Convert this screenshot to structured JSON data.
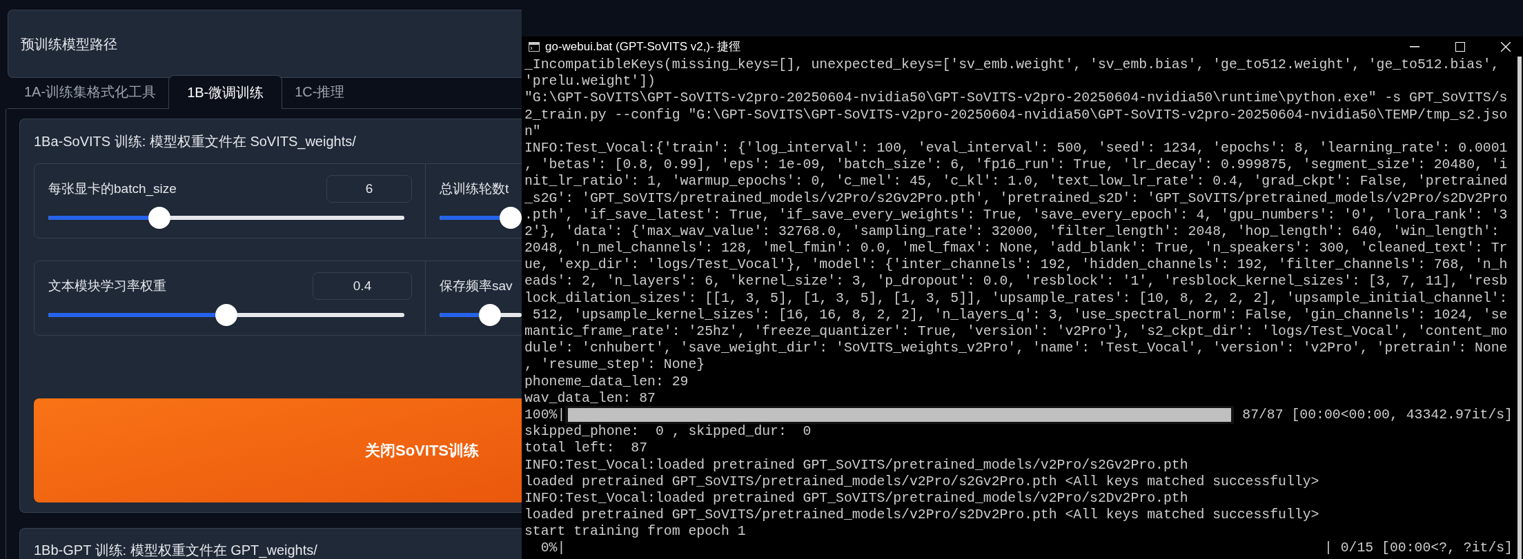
{
  "header": {
    "title": "预训练模型路径"
  },
  "tabs": [
    {
      "label": "1A-训练集格式化工具",
      "selected": false
    },
    {
      "label": "1B-微调训练",
      "selected": true
    },
    {
      "label": "1C-推理",
      "selected": false
    }
  ],
  "sovits_section": {
    "title": "1Ba-SoVITS 训练: 模型权重文件在 SoVITS_weights/",
    "sliders": [
      {
        "label": "每张显卡的batch_size",
        "value": "6",
        "level": 0.3
      },
      {
        "label": "总训练轮数t",
        "level": 1
      },
      {
        "label": "文本模块学习率权重",
        "value": "0.4",
        "level": 0.5
      },
      {
        "label": "保存频率sav",
        "level": 0.66
      }
    ],
    "button": "关闭SoVITS训练"
  },
  "gpt_section": {
    "title": "1Bb-GPT 训练: 模型权重文件在 GPT_weights/"
  },
  "terminal": {
    "title": "go-webui.bat (GPT-SoVITS v2,)- 捷徑",
    "lines": [
      {
        "kind": "text",
        "text": "_IncompatibleKeys(missing_keys=[], unexpected_keys=['sv_emb.weight', 'sv_emb.bias', 'ge_to512.weight', 'ge_to512.bias',"
      },
      {
        "kind": "text",
        "text": "'prelu.weight'])"
      },
      {
        "kind": "text",
        "text": "\"G:\\GPT-SoVITS\\GPT-SoVITS-v2pro-20250604-nvidia50\\GPT-SoVITS-v2pro-20250604-nvidia50\\runtime\\python.exe\" -s GPT_SoVITS/s"
      },
      {
        "kind": "text",
        "text": "2_train.py --config \"G:\\GPT-SoVITS\\GPT-SoVITS-v2pro-20250604-nvidia50\\GPT-SoVITS-v2pro-20250604-nvidia50\\TEMP/tmp_s2.jso"
      },
      {
        "kind": "text",
        "text": "n\""
      },
      {
        "kind": "text",
        "text": "INFO:Test_Vocal:{'train': {'log_interval': 100, 'eval_interval': 500, 'seed': 1234, 'epochs': 8, 'learning_rate': 0.0001"
      },
      {
        "kind": "text",
        "text": ", 'betas': [0.8, 0.99], 'eps': 1e-09, 'batch_size': 6, 'fp16_run': True, 'lr_decay': 0.999875, 'segment_size': 20480, 'i"
      },
      {
        "kind": "text",
        "text": "nit_lr_ratio': 1, 'warmup_epochs': 0, 'c_mel': 45, 'c_kl': 1.0, 'text_low_lr_rate': 0.4, 'grad_ckpt': False, 'pretrained"
      },
      {
        "kind": "text",
        "text": "_s2G': 'GPT_SoVITS/pretrained_models/v2Pro/s2Gv2Pro.pth', 'pretrained_s2D': 'GPT_SoVITS/pretrained_models/v2Pro/s2Dv2Pro"
      },
      {
        "kind": "text",
        "text": ".pth', 'if_save_latest': True, 'if_save_every_weights': True, 'save_every_epoch': 4, 'gpu_numbers': '0', 'lora_rank': '3"
      },
      {
        "kind": "text",
        "text": "2'}, 'data': {'max_wav_value': 32768.0, 'sampling_rate': 32000, 'filter_length': 2048, 'hop_length': 640, 'win_length':"
      },
      {
        "kind": "text",
        "text": "2048, 'n_mel_channels': 128, 'mel_fmin': 0.0, 'mel_fmax': None, 'add_blank': True, 'n_speakers': 300, 'cleaned_text': Tr"
      },
      {
        "kind": "text",
        "text": "ue, 'exp_dir': 'logs/Test_Vocal'}, 'model': {'inter_channels': 192, 'hidden_channels': 192, 'filter_channels': 768, 'n_h"
      },
      {
        "kind": "text",
        "text": "eads': 2, 'n_layers': 6, 'kernel_size': 3, 'p_dropout': 0.0, 'resblock': '1', 'resblock_kernel_sizes': [3, 7, 11], 'resb"
      },
      {
        "kind": "text",
        "text": "lock_dilation_sizes': [[1, 3, 5], [1, 3, 5], [1, 3, 5]], 'upsample_rates': [10, 8, 2, 2, 2], 'upsample_initial_channel':"
      },
      {
        "kind": "text",
        "text": " 512, 'upsample_kernel_sizes': [16, 16, 8, 2, 2], 'n_layers_q': 3, 'use_spectral_norm': False, 'gin_channels': 1024, 'se"
      },
      {
        "kind": "text",
        "text": "mantic_frame_rate': '25hz', 'freeze_quantizer': True, 'version': 'v2Pro'}, 's2_ckpt_dir': 'logs/Test_Vocal', 'content_mo"
      },
      {
        "kind": "text",
        "text": "dule': 'cnhubert', 'save_weight_dir': 'SoVITS_weights_v2Pro', 'name': 'Test_Vocal', 'version': 'v2Pro', 'pretrain': None"
      },
      {
        "kind": "text",
        "text": ", 'resume_step': None}"
      },
      {
        "kind": "text",
        "text": "phoneme_data_len: 29"
      },
      {
        "kind": "text",
        "text": "wav_data_len: 87"
      },
      {
        "kind": "progress",
        "percent": "100%|",
        "level": 1,
        "status": " 87/87 [00:00<00:00, 43342.97it/s]"
      },
      {
        "kind": "text",
        "text": "skipped_phone:  0 , skipped_dur:  0"
      },
      {
        "kind": "text",
        "text": "total left:  87"
      },
      {
        "kind": "text",
        "text": "INFO:Test_Vocal:loaded pretrained GPT_SoVITS/pretrained_models/v2Pro/s2Gv2Pro.pth"
      },
      {
        "kind": "text",
        "text": "loaded pretrained GPT_SoVITS/pretrained_models/v2Pro/s2Gv2Pro.pth <All keys matched successfully>"
      },
      {
        "kind": "text",
        "text": "INFO:Test_Vocal:loaded pretrained GPT_SoVITS/pretrained_models/v2Pro/s2Dv2Pro.pth"
      },
      {
        "kind": "text",
        "text": "loaded pretrained GPT_SoVITS/pretrained_models/v2Pro/s2Dv2Pro.pth <All keys matched successfully>"
      },
      {
        "kind": "text",
        "text": "start training from epoch 1"
      },
      {
        "kind": "progress",
        "percent": "  0%|",
        "level": 0,
        "status": "| 0/15 [00:00<?, ?it/s]"
      }
    ]
  }
}
